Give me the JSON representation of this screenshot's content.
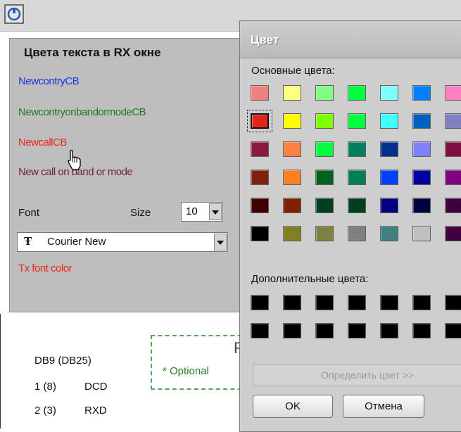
{
  "settings": {
    "heading": "Цвета текста в RX окне",
    "color_items": [
      {
        "label": "NewcontryCB",
        "color": "#1b35d6"
      },
      {
        "label": "NewcontryonbandormodeCB",
        "color": "#1f7a2a"
      },
      {
        "label": "NewcallCB",
        "color": "#e8281e"
      },
      {
        "label": "New call on band or mode",
        "color": "#6b2243"
      }
    ],
    "font_label": "Font",
    "size_label": "Size",
    "size_value": "10",
    "font_value": "Courier New",
    "tx_font_color_label": "Tx font color",
    "tx_font_color": "#e8281e",
    "optional_text": "* Optional",
    "partial_heading": "R",
    "connector_header": "DB9 (DB25)",
    "pins": [
      {
        "num": "1 (8)",
        "signal": "DCD"
      },
      {
        "num": "2 (3)",
        "signal": "RXD"
      }
    ]
  },
  "dialog": {
    "title": "Цвет",
    "basic_colors_label": "Основные цвета:",
    "custom_colors_label": "Дополнительные цвета:",
    "define_button": "Определить цвет >>",
    "ok_button": "OK",
    "cancel_button": "Отмена",
    "selected_swatch": {
      "row": 2,
      "col": 1
    },
    "basic_colors": [
      [
        "#f08080",
        "#ffff80",
        "#80ff80",
        "#00ff40",
        "#80ffff",
        "#0080ff",
        "#ff80c0"
      ],
      [
        "#e0261c",
        "#ffff00",
        "#80ff00",
        "#00ff40",
        "#40ffff",
        "#0060c0",
        "#8080c0"
      ],
      [
        "#8b1a40",
        "#ff8040",
        "#00ff40",
        "#008060",
        "#003090",
        "#8080ff",
        "#801040"
      ],
      [
        "#802010",
        "#ff8020",
        "#006020",
        "#008050",
        "#0040ff",
        "#0000a0",
        "#800080"
      ],
      [
        "#400000",
        "#802000",
        "#004020",
        "#004020",
        "#000080",
        "#000040",
        "#400040"
      ],
      [
        "#000000",
        "#808020",
        "#808040",
        "#808080",
        "#408080",
        "#c0c0c0",
        "#400040"
      ]
    ],
    "custom_colors": [
      [
        "#000000",
        "#000000",
        "#000000",
        "#000000",
        "#000000",
        "#000000",
        "#000000"
      ],
      [
        "#000000",
        "#000000",
        "#000000",
        "#000000",
        "#000000",
        "#000000",
        "#000000"
      ]
    ]
  }
}
